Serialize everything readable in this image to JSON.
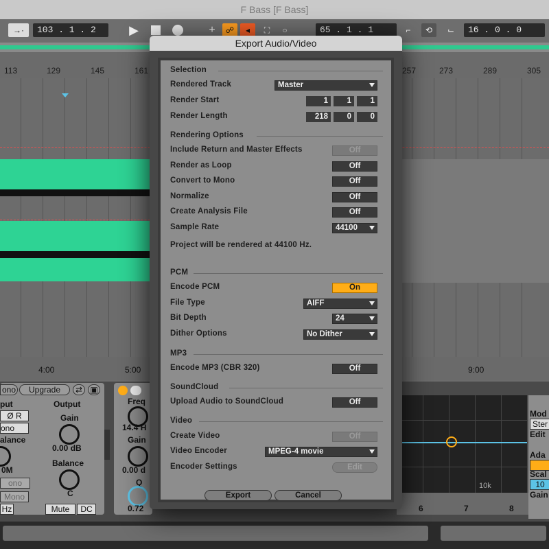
{
  "window": {
    "title": "F Bass  [F Bass]"
  },
  "transport": {
    "position": "103 .  1 .  2",
    "loop_start": "65 .  1 .  1",
    "loop_length": "16 .  0 .  0",
    "accent": "#ff9d1f"
  },
  "ruler": {
    "ticks": [
      "113",
      "129",
      "145",
      "161",
      "257",
      "273",
      "289",
      "305"
    ]
  },
  "timeline": {
    "ticks": [
      "4:00",
      "5:00",
      "9:00"
    ]
  },
  "devices": {
    "mono_label": "ono",
    "upgrade_label": "Upgrade",
    "output_label": "Output",
    "put_label": "put",
    "gain_label": "Gain",
    "gain_value": "0.00 dB",
    "balance_label": "Balance",
    "balance_value": "C",
    "alance_label": "alance",
    "zero_r": "Ø R",
    "om_label": "0M",
    "ono_label": "ono",
    "mono_btn": "Mono",
    "hz_label": "Hz",
    "mute_label": "Mute",
    "dc_label": "DC",
    "freq_label": "Freq",
    "freq_value": "14.4 H",
    "gain2_label": "Gain",
    "gain2_value": "0.00 d",
    "q_label": "Q",
    "q_value": "0.72",
    "eq_label_10k": "10k",
    "band_6": "6",
    "band_7": "7",
    "band_8": "8",
    "right_mode": "Mod",
    "right_ster": "Ster",
    "right_edit": "Edit",
    "right_ada": "Ada",
    "right_scal": "Scal",
    "right_10": "10",
    "right_gain": "Gain"
  },
  "dialog": {
    "title": "Export Audio/Video",
    "selection": {
      "header": "Selection",
      "rendered_track_label": "Rendered Track",
      "rendered_track_value": "Master",
      "render_start_label": "Render Start",
      "render_start": [
        "1",
        "1",
        "1"
      ],
      "render_length_label": "Render Length",
      "render_length": [
        "218",
        "0",
        "0"
      ]
    },
    "rendering": {
      "header": "Rendering Options",
      "include_label": "Include Return and Master Effects",
      "include_value": "Off",
      "loop_label": "Render as Loop",
      "loop_value": "Off",
      "mono_label": "Convert to Mono",
      "mono_value": "Off",
      "normalize_label": "Normalize",
      "normalize_value": "Off",
      "analysis_label": "Create Analysis File",
      "analysis_value": "Off",
      "sample_rate_label": "Sample Rate",
      "sample_rate_value": "44100",
      "info": "Project will be rendered at 44100 Hz."
    },
    "pcm": {
      "header": "PCM",
      "encode_label": "Encode PCM",
      "encode_value": "On",
      "file_type_label": "File Type",
      "file_type_value": "AIFF",
      "bit_depth_label": "Bit Depth",
      "bit_depth_value": "24",
      "dither_label": "Dither Options",
      "dither_value": "No Dither"
    },
    "mp3": {
      "header": "MP3",
      "encode_label": "Encode MP3 (CBR 320)",
      "encode_value": "Off"
    },
    "soundcloud": {
      "header": "SoundCloud",
      "upload_label": "Upload Audio to SoundCloud",
      "upload_value": "Off"
    },
    "video": {
      "header": "Video",
      "create_label": "Create Video",
      "create_value": "Off",
      "encoder_label": "Video Encoder",
      "encoder_value": "MPEG-4 movie",
      "settings_label": "Encoder Settings",
      "settings_value": "Edit"
    },
    "buttons": {
      "export": "Export",
      "cancel": "Cancel"
    },
    "colors": {
      "on": "#ffad17",
      "switch_bg": "#3a3a3a"
    }
  }
}
